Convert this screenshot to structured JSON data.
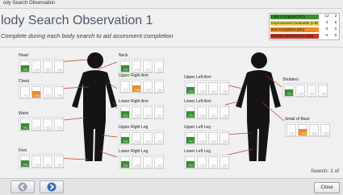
{
  "window": {
    "title": "ody Search Observation"
  },
  "page": {
    "title": "lody Search Observation 1",
    "subtitle": "Complete during each body search to aid assesment completion"
  },
  "legend": {
    "rows": [
      {
        "label": "Fully Compliant (FC)",
        "color": "#3d8b37",
        "v1": "12",
        "v2": "2"
      },
      {
        "label": "Improvement Desirable (CID)",
        "color": "#f0d24a",
        "v1": "3",
        "v2": "5"
      },
      {
        "label": "Non Compliant (NC)",
        "color": "#f08a20",
        "v1": "0",
        "v2": "0"
      },
      {
        "label": "Serious Deficiencies (SD)",
        "color": "#c0392b",
        "v1": "0",
        "v2": "0"
      }
    ]
  },
  "status_colors": {
    "FC": "#3d8b37",
    "CID": "#f08a20"
  },
  "regions": {
    "head": {
      "label": "Head",
      "codes": [
        "FC",
        "CID",
        "NC",
        "SD"
      ],
      "selected": "FC"
    },
    "neck": {
      "label": "Neck",
      "codes": [
        "FC",
        "CID",
        "NC",
        "SD"
      ],
      "selected": "FC"
    },
    "chest": {
      "label": "Chest",
      "codes": [
        "FC",
        "CID",
        "NC",
        "SD"
      ],
      "selected": "CID"
    },
    "upper_right_arm": {
      "label": "Upper Right Arm",
      "codes": [
        "FC",
        "CID",
        "NC",
        "SD"
      ],
      "selected": "CID"
    },
    "lower_right_arm": {
      "label": "Lower Right Arm",
      "codes": [
        "FC",
        "CID",
        "NC",
        "SD"
      ],
      "selected": "FC"
    },
    "waist": {
      "label": "Waist",
      "codes": [
        "FC",
        "CID",
        "NC",
        "SD"
      ],
      "selected": "FC"
    },
    "upper_right_leg": {
      "label": "Upper Right Leg",
      "codes": [
        "FC",
        "CID",
        "NC",
        "SD"
      ],
      "selected": "FC"
    },
    "feet": {
      "label": "Feet",
      "codes": [
        "FC",
        "CID",
        "NC",
        "SD"
      ],
      "selected": "FC"
    },
    "lower_right_leg": {
      "label": "Lower Right Leg",
      "codes": [
        "FC",
        "CID",
        "NC",
        "SD"
      ],
      "selected": "FC"
    },
    "upper_left_arm": {
      "label": "Upper Left Arm",
      "codes": [
        "FC",
        "CID",
        "NC",
        "SD"
      ],
      "selected": "FC"
    },
    "lower_left_arm": {
      "label": "Lower Left Arm",
      "codes": [
        "FC",
        "CID",
        "NC",
        "SD"
      ],
      "selected": "FC"
    },
    "upper_left_leg": {
      "label": "Upper Left Leg",
      "codes": [
        "FC",
        "CID",
        "NC",
        "SD"
      ],
      "selected": "FC"
    },
    "lower_left_leg": {
      "label": "Lower Left Leg",
      "codes": [
        "FC",
        "CID",
        "NC",
        "SD"
      ],
      "selected": "FC"
    },
    "shoulders": {
      "label": "Sholders",
      "codes": [
        "FC",
        "CID",
        "NC",
        "SD"
      ],
      "selected": "FC"
    },
    "small_of_back": {
      "label": "Small of Back",
      "codes": [
        "FC",
        "CID",
        "NC",
        "SD"
      ],
      "selected": "CID"
    }
  },
  "search_status": "Search: 1 of",
  "footer": {
    "close_label": "Close",
    "back_icon": "back-arrow-icon",
    "forward_icon": "forward-arrow-icon"
  }
}
